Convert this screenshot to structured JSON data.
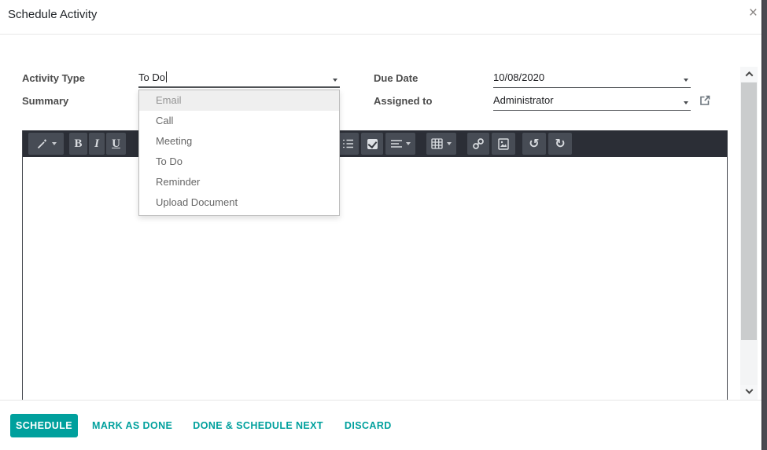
{
  "modal": {
    "title": "Schedule Activity"
  },
  "icons": {
    "close": "×",
    "undo": "↺",
    "redo": "↻"
  },
  "form": {
    "activity_type": {
      "label": "Activity Type",
      "value": "To Do"
    },
    "summary": {
      "label": "Summary",
      "value": ""
    },
    "due_date": {
      "label": "Due Date",
      "value": "10/08/2020"
    },
    "assigned_to": {
      "label": "Assigned to",
      "value": "Administrator"
    }
  },
  "activity_dropdown": {
    "highlighted": "Email",
    "items": [
      "Email",
      "Call",
      "Meeting",
      "To Do",
      "Reminder",
      "Upload Document"
    ]
  },
  "editor_toolbar": {
    "bold": "B",
    "italic": "I",
    "underline": "U",
    "buttons": [
      "style",
      "bold",
      "italic",
      "underline",
      "ordered-list",
      "checklist",
      "paragraph-align",
      "table",
      "link",
      "image",
      "undo",
      "redo"
    ]
  },
  "footer": {
    "buttons": [
      {
        "label": "SCHEDULE",
        "primary": true
      },
      {
        "label": "MARK AS DONE"
      },
      {
        "label": "DONE & SCHEDULE NEXT"
      },
      {
        "label": "DISCARD"
      }
    ]
  },
  "colors": {
    "accent": "#00a09d",
    "toolbar_bg": "#2b2e36",
    "toolbar_button_bg": "#474c55",
    "highlight_row": "#efefef"
  }
}
